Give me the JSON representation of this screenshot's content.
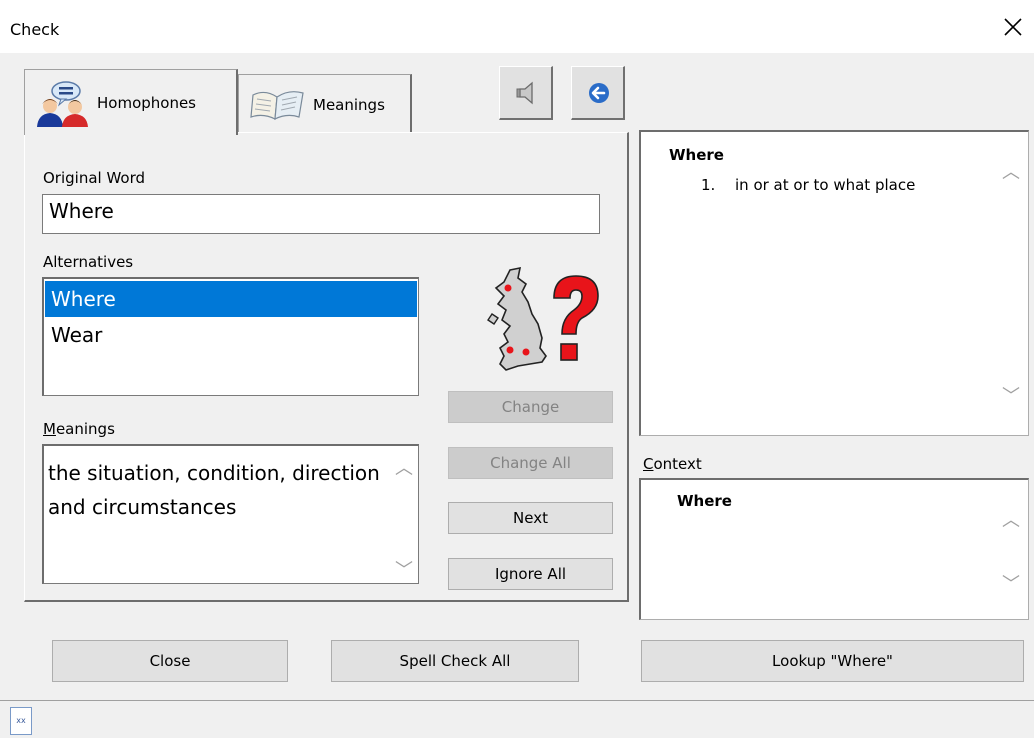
{
  "window": {
    "title": "Check"
  },
  "tabs": [
    {
      "label": "Homophones",
      "icon": "people-speech-icon",
      "active": true
    },
    {
      "label": "Meanings",
      "icon": "open-book-icon",
      "active": false
    }
  ],
  "toolbar": {
    "speak_icon": "speaker-icon",
    "back_icon": "back-arrow-icon"
  },
  "original_word": {
    "label": "Original Word",
    "value": "Where"
  },
  "alternatives": {
    "label": "Alternatives",
    "items": [
      "Where",
      "Wear"
    ],
    "selected": "Where"
  },
  "meanings": {
    "label": "Meanings",
    "text": "the situation, condition, direction and circumstances"
  },
  "buttons": {
    "change": "Change",
    "change_all": "Change All",
    "next": "Next",
    "ignore_all": "Ignore All"
  },
  "definition": {
    "word": "Where",
    "number": "1.",
    "text": "in or at or to what place"
  },
  "context": {
    "label": "Context",
    "text": "Where"
  },
  "footer": {
    "close": "Close",
    "spell_check_all": "Spell Check All",
    "lookup": "Lookup \"Where\""
  },
  "status": {
    "icon_text": "xx"
  },
  "colors": {
    "selection": "#0078d7",
    "question_mark": "#e8141a"
  }
}
